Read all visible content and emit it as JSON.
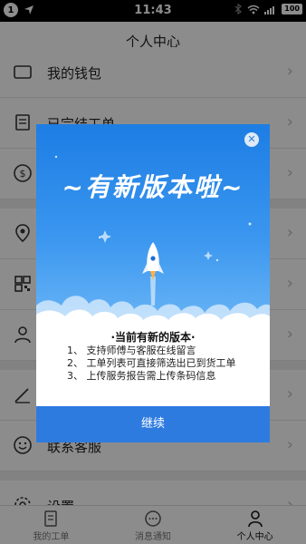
{
  "status_bar": {
    "notification_count": "1",
    "time": "11:43",
    "battery": "100"
  },
  "header": {
    "title": "个人中心"
  },
  "list": {
    "items": [
      {
        "label": "我的钱包",
        "icon": "wallet-icon"
      },
      {
        "label": "已完结工单",
        "icon": "document-icon"
      },
      {
        "label": "",
        "icon": "dollar-icon"
      },
      {
        "label": "",
        "icon": "location-icon"
      },
      {
        "label": "",
        "icon": "qr-code-icon"
      },
      {
        "label": "",
        "icon": "user-icon"
      },
      {
        "label": "",
        "icon": "edit-icon"
      },
      {
        "label": "联系客服",
        "icon": "smile-icon"
      },
      {
        "label": "设置",
        "icon": "gear-icon"
      }
    ]
  },
  "tabbar": {
    "tabs": [
      {
        "label": "我的工单",
        "icon": "document-icon"
      },
      {
        "label": "消息通知",
        "icon": "message-icon"
      },
      {
        "label": "个人中心",
        "icon": "user-icon",
        "active": true
      }
    ]
  },
  "dialog": {
    "title": "~有新版本啦~",
    "subtitle": "·当前有新的版本·",
    "items": [
      "1、 支持师傅与客服在线留言",
      "2、 工单列表可直接筛选出已到货工单",
      "3、 上传服务报告需上传条码信息"
    ],
    "button_label": "继续",
    "close_icon": "close-icon",
    "accent_color": "#2e7be0"
  }
}
